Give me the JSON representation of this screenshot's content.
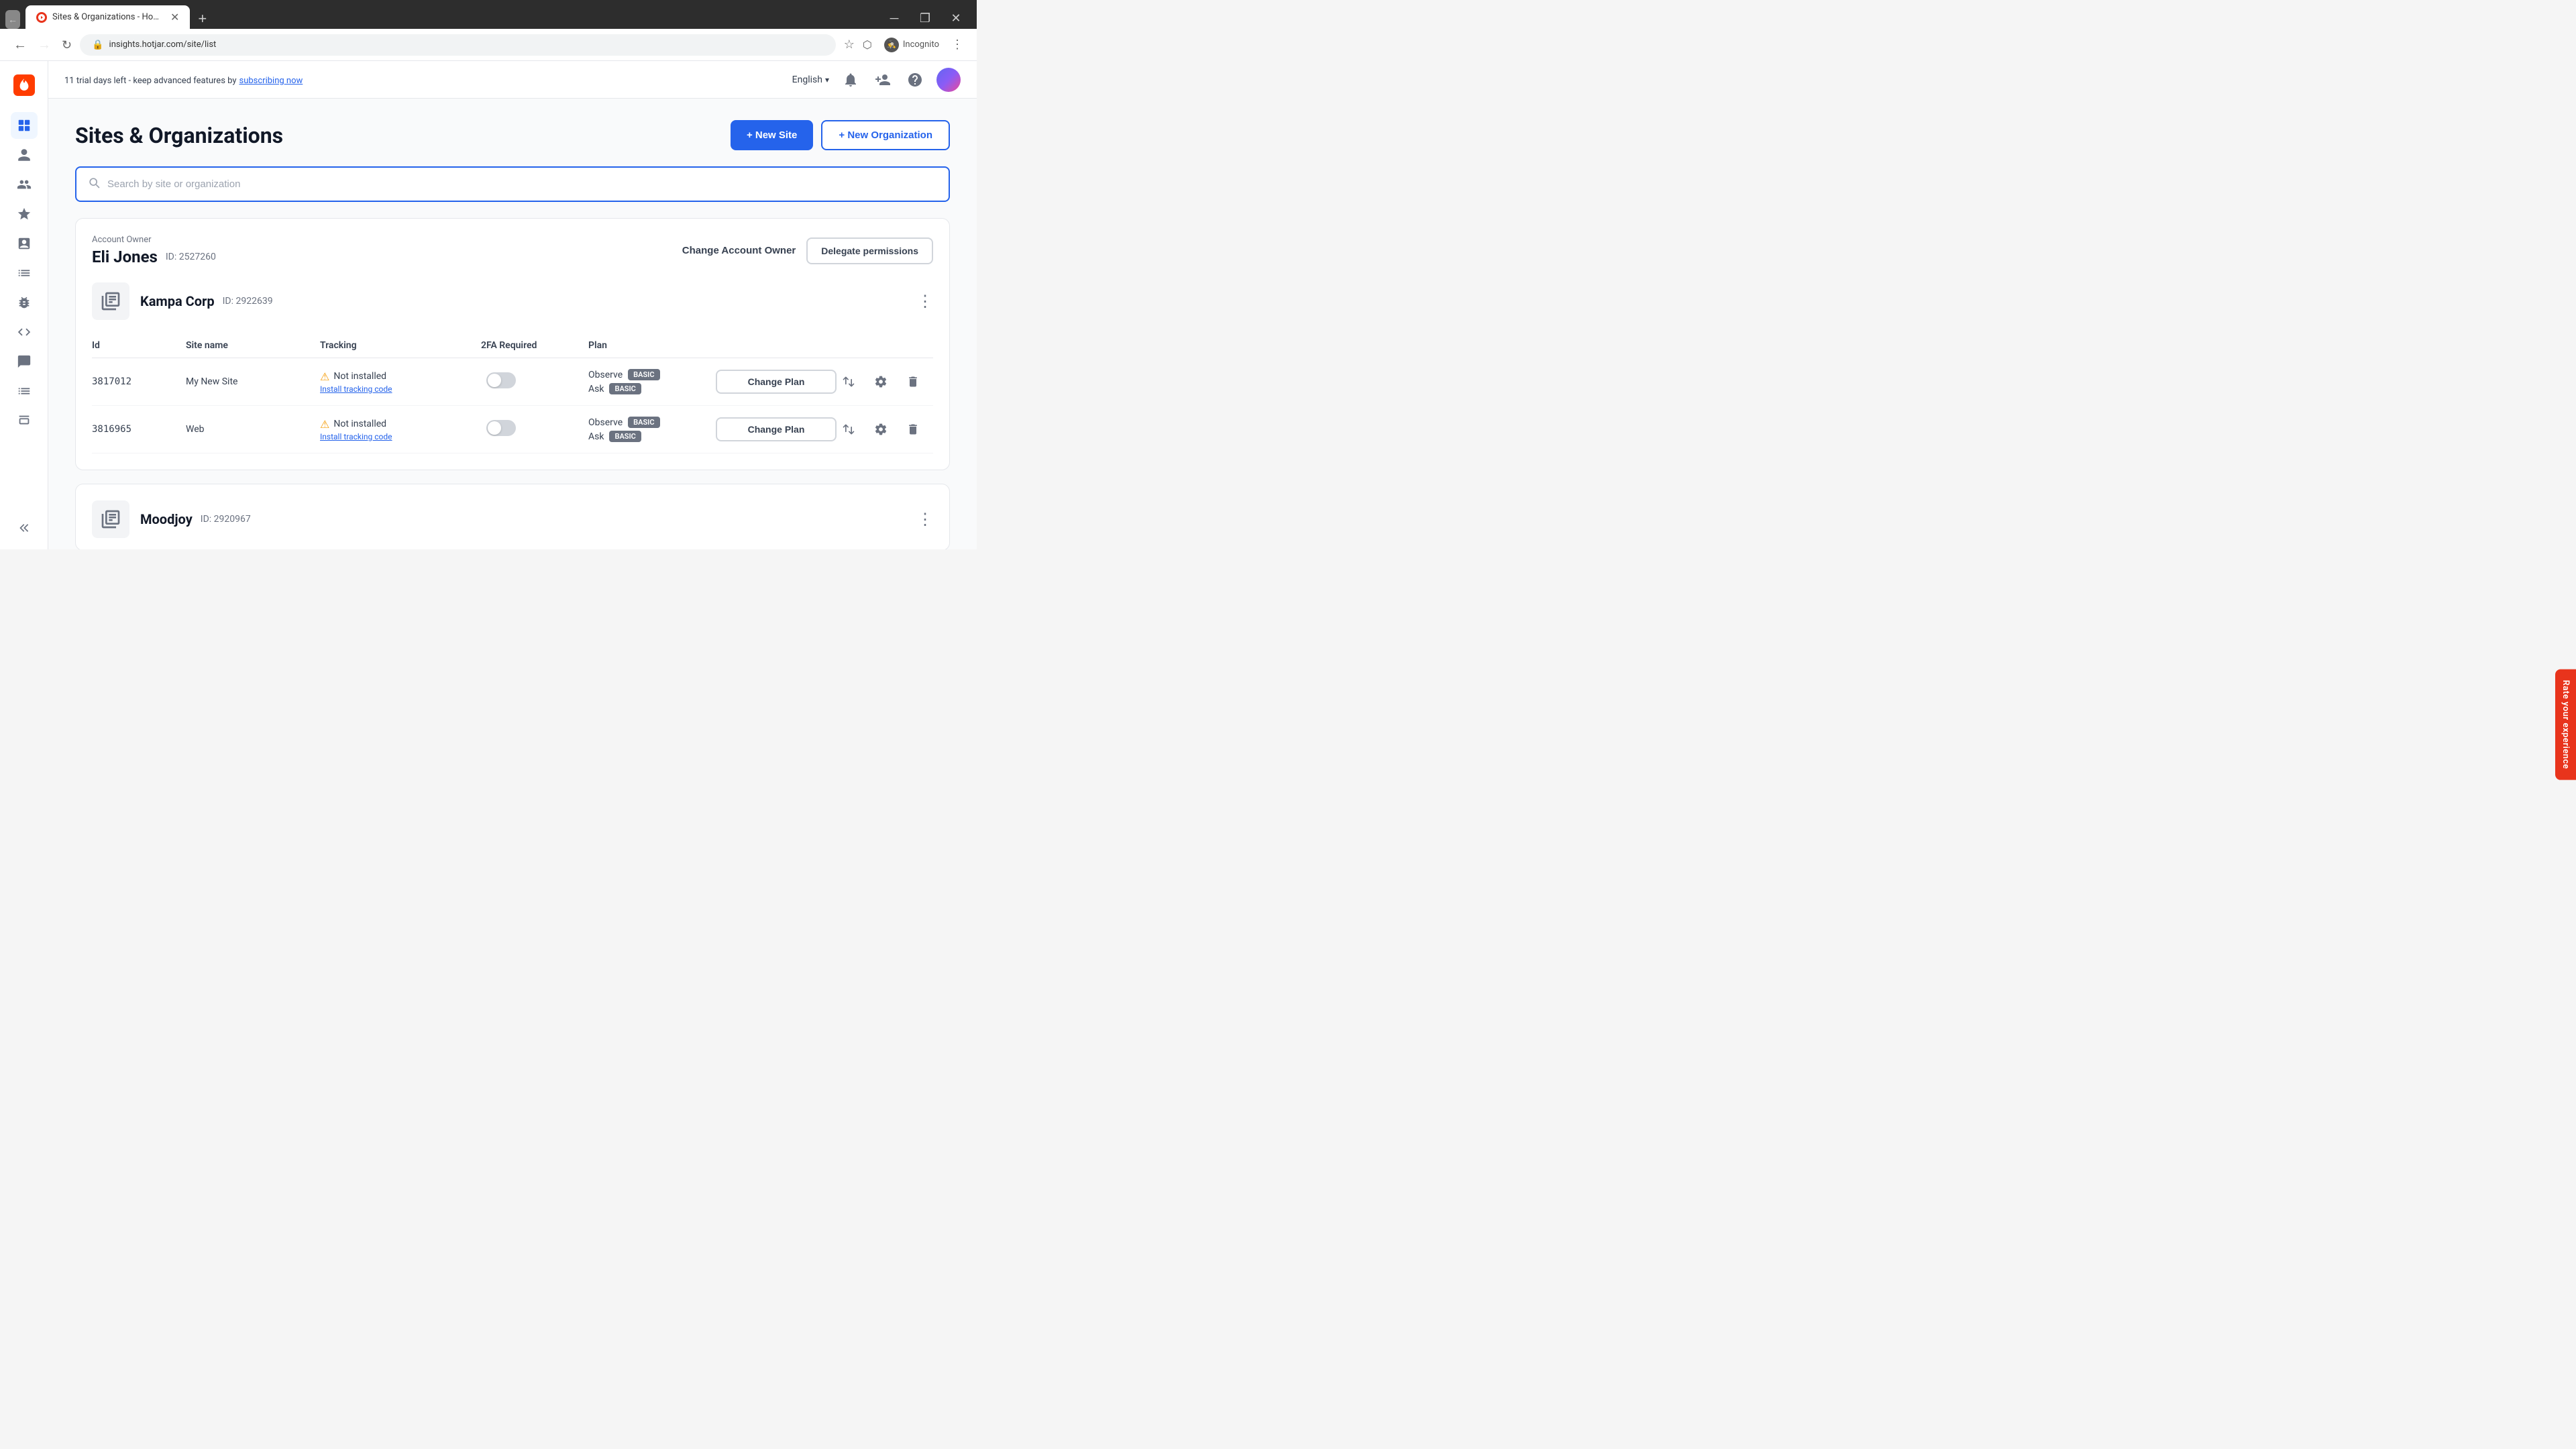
{
  "browser": {
    "tab_title": "Sites & Organizations - Hotjar",
    "url": "insights.hotjar.com/site/list",
    "incognito_label": "Incognito"
  },
  "top_bar": {
    "trial_notice": "11 trial days left - keep advanced features by",
    "trial_link_text": "subscribing now",
    "language": "English",
    "language_icon": "▾"
  },
  "page": {
    "title": "Sites & Organizations",
    "new_site_label": "+ New Site",
    "new_org_label": "+ New Organization",
    "search_placeholder": "Search by site or organization",
    "account_label": "Account Owner",
    "account_name": "Eli Jones",
    "account_id": "ID: 2527260",
    "change_account_owner_label": "Change Account Owner",
    "delegate_permissions_label": "Delegate permissions"
  },
  "organizations": [
    {
      "id": "2922639",
      "name": "Kampa Corp",
      "sites": [
        {
          "id": "3817012",
          "name": "My New Site",
          "tracking": "Not installed",
          "install_link": "Install tracking code",
          "plan_observe": "Observe",
          "plan_ask": "Ask",
          "badge_observe": "BASIC",
          "badge_ask": "BASIC",
          "change_plan_label": "Change Plan"
        },
        {
          "id": "3816965",
          "name": "Web",
          "tracking": "Not installed",
          "install_link": "Install tracking code",
          "plan_observe": "Observe",
          "plan_ask": "Ask",
          "badge_observe": "BASIC",
          "badge_ask": "BASIC",
          "change_plan_label": "Change Plan"
        }
      ]
    },
    {
      "id": "2920967",
      "name": "Moodjoy",
      "sites": []
    }
  ],
  "table_headers": {
    "id": "Id",
    "site_name": "Site name",
    "tracking": "Tracking",
    "tfa": "2FA Required",
    "plan": "Plan"
  },
  "rate_experience_label": "Rate your experience"
}
